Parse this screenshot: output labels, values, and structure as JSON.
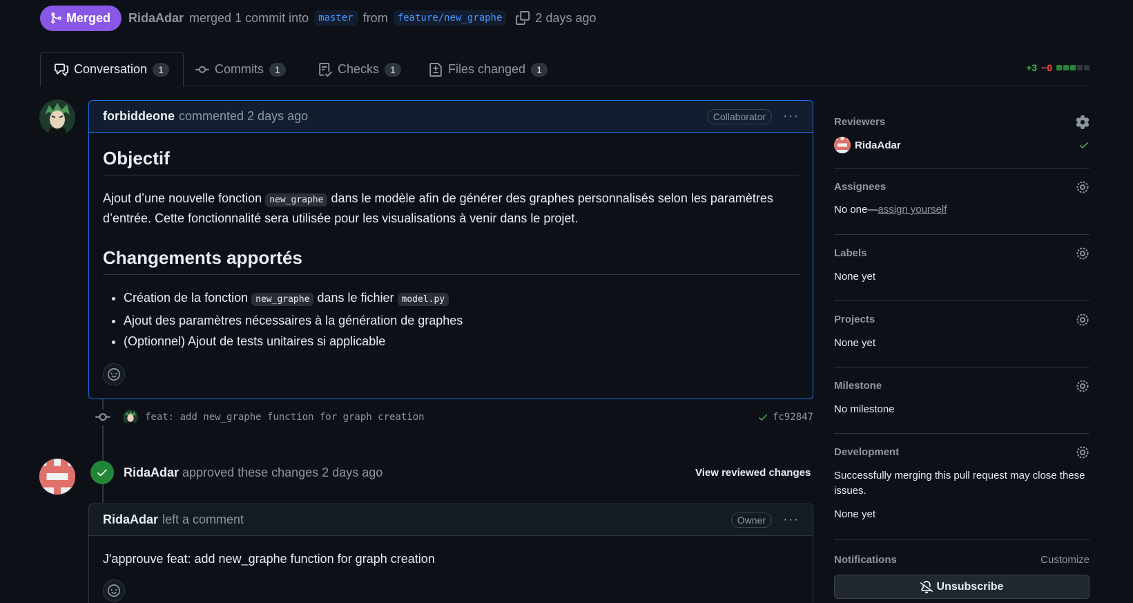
{
  "header": {
    "state_label": "Merged",
    "author": "RidaAdar",
    "merge_text": "merged 1 commit into",
    "base_branch": "master",
    "from_text": "from",
    "head_branch": "feature/new_graphe",
    "time": "2 days ago"
  },
  "tabs": [
    {
      "label": "Conversation",
      "count": "1",
      "icon": "comment-discussion-icon"
    },
    {
      "label": "Commits",
      "count": "1",
      "icon": "git-commit-icon"
    },
    {
      "label": "Checks",
      "count": "1",
      "icon": "checklist-icon"
    },
    {
      "label": "Files changed",
      "count": "1",
      "icon": "file-diff-icon"
    }
  ],
  "diffstat": {
    "additions": "+3",
    "deletions": "−0",
    "colors": [
      "#238636",
      "#238636",
      "#238636",
      "#30363d",
      "#30363d"
    ]
  },
  "comment1": {
    "author": "forbiddeone",
    "meta": "commented 2 days ago",
    "role": "Collaborator",
    "h1": "Objectif",
    "p_before": "Ajout d’une nouvelle fonction",
    "p_code": "new_graphe",
    "p_after": "dans le modèle afin de générer des graphes personnalisés selon les paramètres d’entrée. Cette fonctionnalité sera utilisée pour les visualisations à venir dans le projet.",
    "h2": "Changements apportés",
    "li1_a": "Création de la fonction",
    "li1_code1": "new_graphe",
    "li1_b": "dans le fichier",
    "li1_code2": "model.py",
    "li2": "Ajout des paramètres nécessaires à la génération de graphes",
    "li3": "(Optionnel) Ajout de tests unitaires si applicable"
  },
  "commit": {
    "message": "feat: add new_graphe function for graph creation",
    "sha": "fc92847"
  },
  "review": {
    "author": "RidaAdar",
    "action": "approved these changes 2 days ago",
    "view_label": "View reviewed changes"
  },
  "comment2": {
    "author": "RidaAdar",
    "meta": "left a comment",
    "role": "Owner",
    "body": "J'approuve feat: add new_graphe function for graph creation"
  },
  "sidebar": {
    "reviewers": {
      "title": "Reviewers",
      "name": "RidaAdar"
    },
    "assignees": {
      "title": "Assignees",
      "value": "No one—",
      "link": "assign yourself"
    },
    "labels": {
      "title": "Labels",
      "value": "None yet"
    },
    "projects": {
      "title": "Projects",
      "value": "None yet"
    },
    "milestone": {
      "title": "Milestone",
      "value": "No milestone"
    },
    "development": {
      "title": "Development",
      "desc": "Successfully merging this pull request may close these issues.",
      "value": "None yet"
    },
    "notifications": {
      "title": "Notifications",
      "customize": "Customize",
      "button": "Unsubscribe"
    }
  }
}
